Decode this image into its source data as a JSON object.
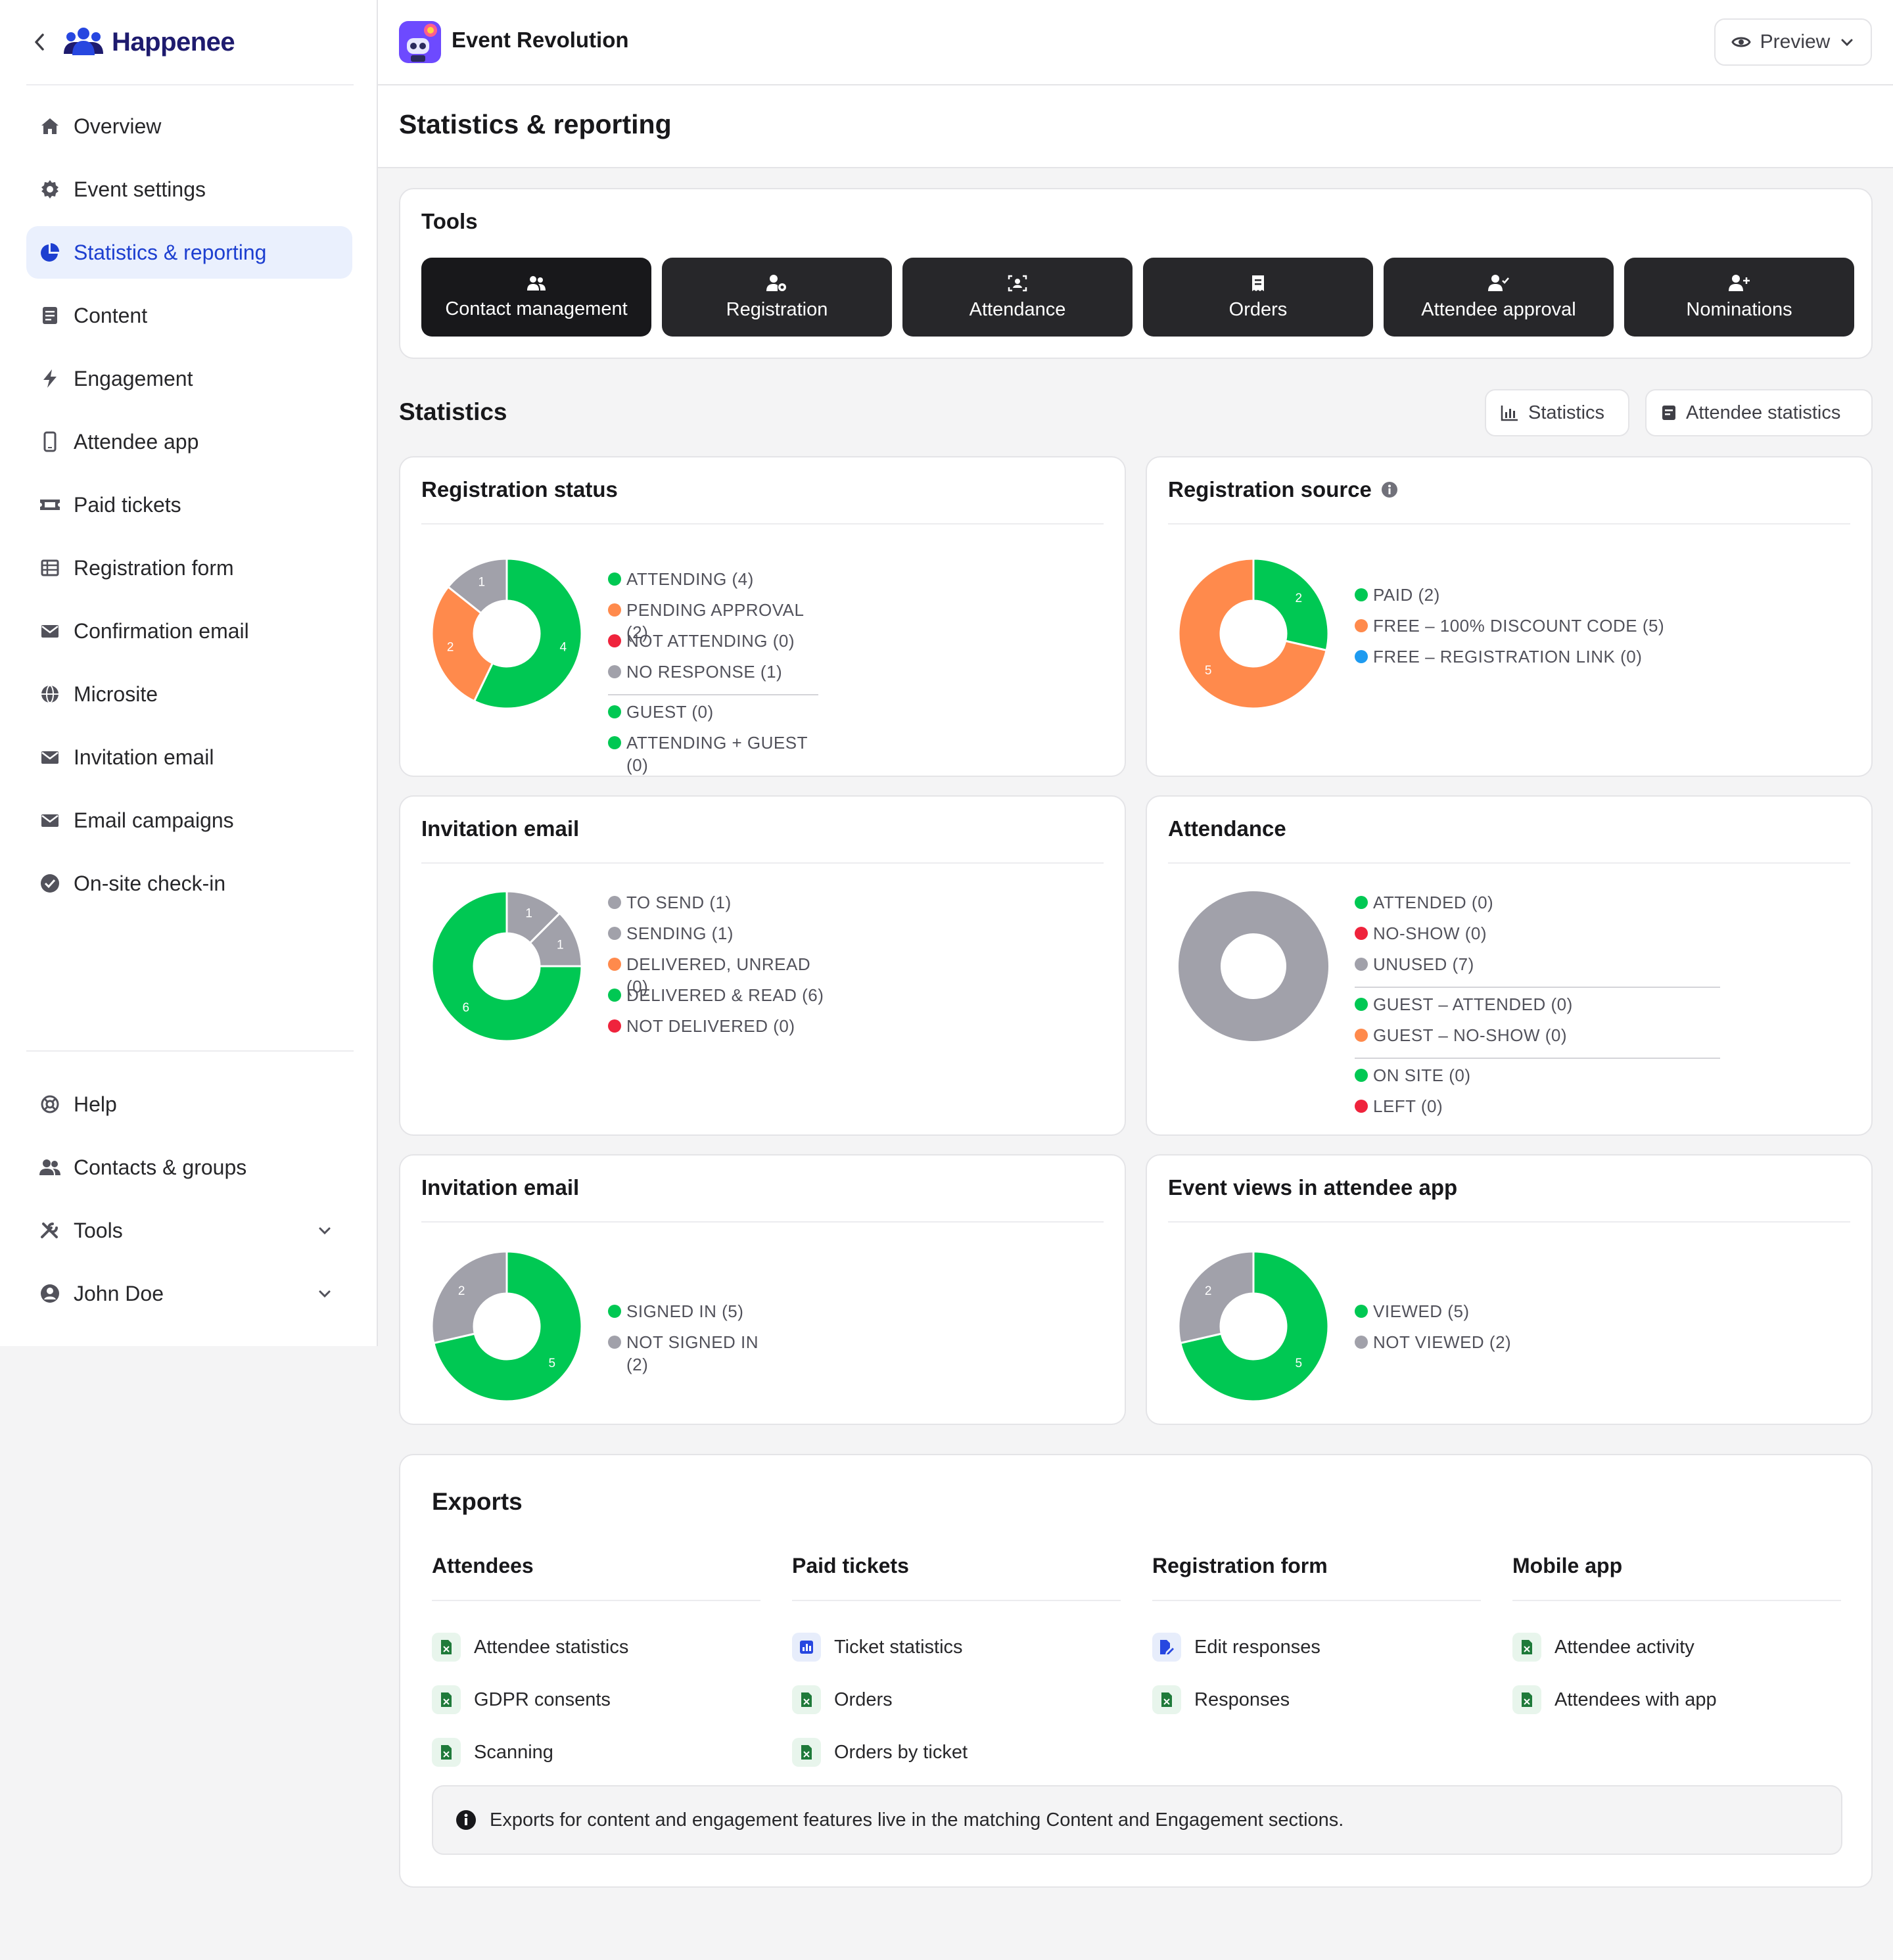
{
  "brand": {
    "name": "Happenee"
  },
  "sidebar": {
    "items": [
      {
        "label": "Overview",
        "icon": "home-icon"
      },
      {
        "label": "Event settings",
        "icon": "gear-icon"
      },
      {
        "label": "Statistics & reporting",
        "icon": "pie-chart-icon",
        "active": true
      },
      {
        "label": "Content",
        "icon": "document-icon"
      },
      {
        "label": "Engagement",
        "icon": "lightning-icon"
      },
      {
        "label": "Attendee app",
        "icon": "phone-icon"
      },
      {
        "label": "Paid tickets",
        "icon": "ticket-icon"
      },
      {
        "label": "Registration form",
        "icon": "table-icon"
      },
      {
        "label": "Confirmation email",
        "icon": "envelope-icon"
      },
      {
        "label": "Microsite",
        "icon": "globe-icon"
      },
      {
        "label": "Invitation email",
        "icon": "envelope-icon"
      },
      {
        "label": "Email campaigns",
        "icon": "envelope-icon"
      },
      {
        "label": "On-site check-in",
        "icon": "check-circle-icon"
      }
    ],
    "bottom_items": [
      {
        "label": "Help",
        "icon": "lifebuoy-icon"
      },
      {
        "label": "Contacts & groups",
        "icon": "users-icon"
      },
      {
        "label": "Tools",
        "icon": "tools-icon"
      },
      {
        "label": "John Doe",
        "icon": "user-circle-icon"
      }
    ]
  },
  "header": {
    "event_name": "Event Revolution",
    "preview_label": "Preview"
  },
  "page": {
    "title": "Statistics & reporting"
  },
  "tools": {
    "title": "Tools",
    "buttons": [
      "Contact management",
      "Registration",
      "Attendance",
      "Orders",
      "Attendee approval",
      "Nominations"
    ]
  },
  "statistics": {
    "title": "Statistics",
    "toggle_statistics": "Statistics",
    "toggle_attendee_statistics": "Attendee statistics"
  },
  "colors": {
    "green": "#00c853",
    "orange": "#ff8a4c",
    "red": "#ef233c",
    "gray": "#a1a1aa",
    "blue": "#1e9bf0",
    "accent": "#1d3fd0"
  },
  "chart_data": [
    {
      "type": "pie",
      "title": "Registration status",
      "series": [
        {
          "name": "ATTENDING",
          "value": 4,
          "color": "green"
        },
        {
          "name": "PENDING APPROVAL",
          "value": 2,
          "color": "orange"
        },
        {
          "name": "NOT ATTENDING",
          "value": 0,
          "color": "red"
        },
        {
          "name": "NO RESPONSE",
          "value": 1,
          "color": "gray"
        }
      ],
      "legend": [
        {
          "text": "ATTENDING (4)",
          "color": "green"
        },
        {
          "text": "PENDING APPROVAL (2)",
          "color": "orange"
        },
        {
          "text": "NOT ATTENDING (0)",
          "color": "red"
        },
        {
          "text": "NO RESPONSE (1)",
          "color": "gray"
        },
        {
          "divider": true
        },
        {
          "text": "GUEST (0)",
          "color": "green"
        },
        {
          "text": "ATTENDING + GUEST (0)",
          "color": "green"
        }
      ]
    },
    {
      "type": "pie",
      "title": "Registration source",
      "series": [
        {
          "name": "PAID",
          "value": 2,
          "color": "green"
        },
        {
          "name": "FREE – 100% DISCOUNT CODE",
          "value": 5,
          "color": "orange"
        },
        {
          "name": "FREE – REGISTRATION LINK",
          "value": 0,
          "color": "blue"
        }
      ],
      "legend": [
        {
          "text": "PAID (2)",
          "color": "green"
        },
        {
          "text": "FREE – 100% DISCOUNT CODE (5)",
          "color": "orange"
        },
        {
          "text": "FREE – REGISTRATION LINK (0)",
          "color": "blue"
        }
      ]
    },
    {
      "type": "pie",
      "title": "Invitation email",
      "series": [
        {
          "name": "TO SEND",
          "value": 1,
          "color": "gray"
        },
        {
          "name": "SENDING",
          "value": 1,
          "color": "gray"
        },
        {
          "name": "DELIVERED, UNREAD",
          "value": 0,
          "color": "orange"
        },
        {
          "name": "DELIVERED & READ",
          "value": 6,
          "color": "green"
        },
        {
          "name": "NOT DELIVERED",
          "value": 0,
          "color": "red"
        }
      ],
      "legend": [
        {
          "text": "TO SEND (1)",
          "color": "gray"
        },
        {
          "text": "SENDING (1)",
          "color": "gray"
        },
        {
          "text": "DELIVERED, UNREAD (0)",
          "color": "orange"
        },
        {
          "text": "DELIVERED & READ (6)",
          "color": "green"
        },
        {
          "text": "NOT DELIVERED (0)",
          "color": "red"
        }
      ]
    },
    {
      "type": "pie",
      "title": "Attendance",
      "series": [
        {
          "name": "ATTENDED",
          "value": 0,
          "color": "green"
        },
        {
          "name": "NO-SHOW",
          "value": 0,
          "color": "red"
        },
        {
          "name": "UNUSED",
          "value": 7,
          "color": "gray"
        }
      ],
      "legend": [
        {
          "text": "ATTENDED (0)",
          "color": "green"
        },
        {
          "text": "NO-SHOW (0)",
          "color": "red"
        },
        {
          "text": "UNUSED (7)",
          "color": "gray"
        },
        {
          "divider": true
        },
        {
          "text": "GUEST – ATTENDED (0)",
          "color": "green"
        },
        {
          "text": "GUEST – NO-SHOW (0)",
          "color": "orange"
        },
        {
          "divider": true
        },
        {
          "text": "ON SITE (0)",
          "color": "green"
        },
        {
          "text": "LEFT (0)",
          "color": "red"
        }
      ]
    },
    {
      "type": "pie",
      "title": "Invitation email",
      "series": [
        {
          "name": "SIGNED IN",
          "value": 5,
          "color": "green"
        },
        {
          "name": "NOT SIGNED IN",
          "value": 2,
          "color": "gray"
        }
      ],
      "legend": [
        {
          "text": "SIGNED IN (5)",
          "color": "green"
        },
        {
          "text": "NOT SIGNED IN (2)",
          "color": "gray"
        }
      ]
    },
    {
      "type": "pie",
      "title": "Event views in attendee app",
      "series": [
        {
          "name": "VIEWED",
          "value": 5,
          "color": "green"
        },
        {
          "name": "NOT VIEWED",
          "value": 2,
          "color": "gray"
        }
      ],
      "legend": [
        {
          "text": "VIEWED (5)",
          "color": "green"
        },
        {
          "text": "NOT VIEWED (2)",
          "color": "gray"
        }
      ]
    }
  ],
  "exports": {
    "title": "Exports",
    "columns": [
      {
        "title": "Attendees",
        "items": [
          {
            "label": "Attendee statistics",
            "icon": "spreadsheet-icon"
          },
          {
            "label": "GDPR consents",
            "icon": "spreadsheet-icon"
          },
          {
            "label": "Scanning",
            "icon": "spreadsheet-icon"
          }
        ]
      },
      {
        "title": "Paid tickets",
        "items": [
          {
            "label": "Ticket statistics",
            "icon": "bar-chart-icon"
          },
          {
            "label": "Orders",
            "icon": "spreadsheet-icon"
          },
          {
            "label": "Orders by ticket",
            "icon": "spreadsheet-icon"
          }
        ]
      },
      {
        "title": "Registration form",
        "items": [
          {
            "label": "Edit responses",
            "icon": "edit-document-icon"
          },
          {
            "label": "Responses",
            "icon": "spreadsheet-icon"
          }
        ]
      },
      {
        "title": "Mobile app",
        "items": [
          {
            "label": "Attendee activity",
            "icon": "spreadsheet-icon"
          },
          {
            "label": "Attendees with app",
            "icon": "spreadsheet-icon"
          }
        ]
      }
    ],
    "info": "Exports for content and engagement features live in the matching Content and Engagement sections."
  }
}
